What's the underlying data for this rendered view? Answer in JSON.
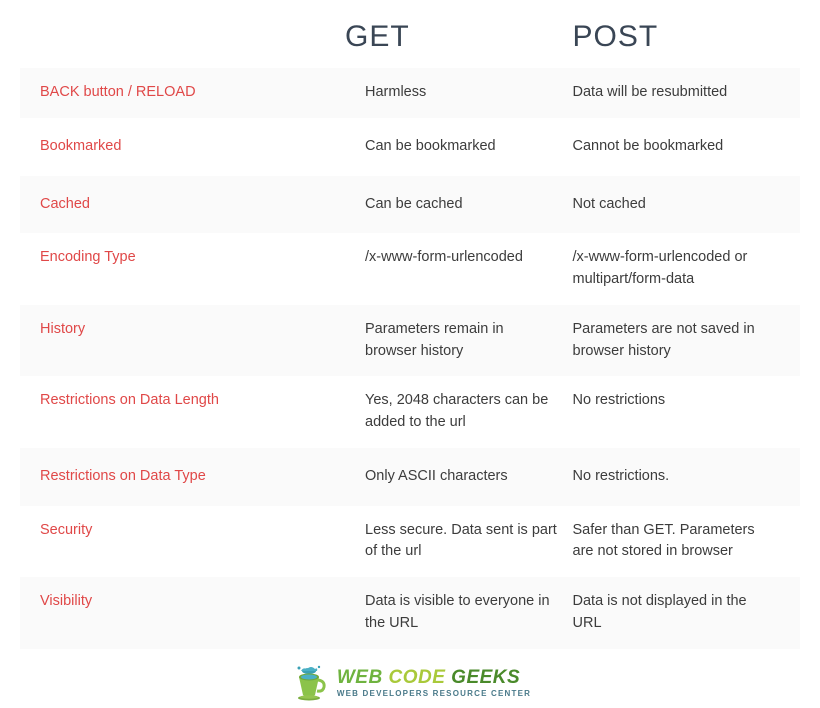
{
  "columns": {
    "label": "",
    "get": "GET",
    "post": "POST"
  },
  "rows": [
    {
      "label": "BACK button / RELOAD",
      "get": "Harmless",
      "post": "Data will be resubmitted"
    },
    {
      "label": "Bookmarked",
      "get": "Can be bookmarked",
      "post": "Cannot be bookmarked"
    },
    {
      "label": "Cached",
      "get": "Can be cached",
      "post": "Not cached"
    },
    {
      "label": "Encoding Type",
      "get": "/x-www-form-urlencoded",
      "post": "/x-www-form-urlencoded or     multipart/form-data"
    },
    {
      "label": "History",
      "get": "Parameters remain in browser history",
      "post": "Parameters are not saved in browser history"
    },
    {
      "label": "Restrictions on Data Length",
      "get": "Yes, 2048 characters can be added to the url",
      "post": "No restrictions"
    },
    {
      "label": "Restrictions on Data Type",
      "get": "Only ASCII characters",
      "post": "No restrictions."
    },
    {
      "label": "Security",
      "get": "Less secure. Data sent is part of the url",
      "post": "Safer than GET. Parameters are not stored in browser"
    },
    {
      "label": "Visibility",
      "get": "Data is visible to everyone in the URL",
      "post": "Data is not displayed in the URL"
    }
  ],
  "footer": {
    "brand_words": [
      "WEB",
      "CODE",
      "GEEKS"
    ],
    "tagline": "WEB DEVELOPERS RESOURCE CENTER"
  }
}
